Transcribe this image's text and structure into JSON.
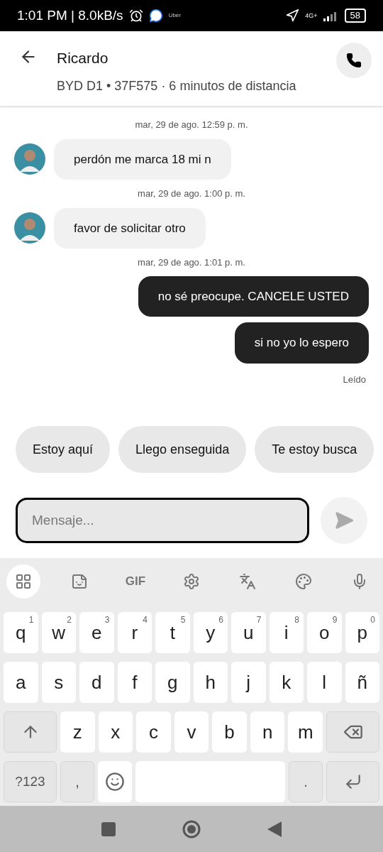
{
  "status_bar": {
    "time": "1:01 PM | 8.0kB/s",
    "app_label": "Uber",
    "network": "4G+",
    "battery": "58"
  },
  "header": {
    "name": "Ricardo",
    "subtitle": "BYD D1 • 37F575 · 6 minutos de distancia"
  },
  "messages": [
    {
      "kind": "timestamp",
      "text": "mar, 29 de ago. 12:59 p. m."
    },
    {
      "kind": "incoming",
      "text": "perdón me marca 18 mi n"
    },
    {
      "kind": "timestamp",
      "text": "mar, 29 de ago. 1:00 p. m."
    },
    {
      "kind": "incoming",
      "text": "favor de solicitar otro"
    },
    {
      "kind": "timestamp",
      "text": "mar, 29 de ago. 1:01 p. m."
    },
    {
      "kind": "outgoing",
      "text": "no sé preocupe. CANCELE USTED"
    },
    {
      "kind": "outgoing",
      "text": "si no yo lo espero"
    },
    {
      "kind": "receipt",
      "text": "Leído"
    }
  ],
  "quick_replies": [
    "Estoy aquí",
    "Llego enseguida",
    "Te estoy busca"
  ],
  "composer": {
    "placeholder": "Mensaje..."
  },
  "keyboard": {
    "toolbar": [
      {
        "kind": "apps"
      },
      {
        "kind": "sticker"
      },
      {
        "kind": "gif",
        "label": "GIF"
      },
      {
        "kind": "settings"
      },
      {
        "kind": "translate"
      },
      {
        "kind": "palette"
      },
      {
        "kind": "mic"
      }
    ],
    "rows": [
      [
        {
          "label": "q",
          "hint": "1"
        },
        {
          "label": "w",
          "hint": "2"
        },
        {
          "label": "e",
          "hint": "3"
        },
        {
          "label": "r",
          "hint": "4"
        },
        {
          "label": "t",
          "hint": "5"
        },
        {
          "label": "y",
          "hint": "6"
        },
        {
          "label": "u",
          "hint": "7"
        },
        {
          "label": "i",
          "hint": "8"
        },
        {
          "label": "o",
          "hint": "9"
        },
        {
          "label": "p",
          "hint": "0"
        }
      ],
      [
        {
          "label": "a"
        },
        {
          "label": "s"
        },
        {
          "label": "d"
        },
        {
          "label": "f"
        },
        {
          "label": "g"
        },
        {
          "label": "h"
        },
        {
          "label": "j"
        },
        {
          "label": "k"
        },
        {
          "label": "l"
        },
        {
          "label": "ñ"
        }
      ],
      [
        {
          "kind": "shift"
        },
        {
          "label": "z"
        },
        {
          "label": "x"
        },
        {
          "label": "c"
        },
        {
          "label": "v"
        },
        {
          "label": "b"
        },
        {
          "label": "n"
        },
        {
          "label": "m"
        },
        {
          "kind": "backspace"
        }
      ],
      [
        {
          "kind": "symbols",
          "label": "?123"
        },
        {
          "kind": "punct",
          "label": ","
        },
        {
          "kind": "emoji"
        },
        {
          "kind": "space"
        },
        {
          "kind": "punct",
          "label": "."
        },
        {
          "kind": "enter"
        }
      ]
    ]
  }
}
